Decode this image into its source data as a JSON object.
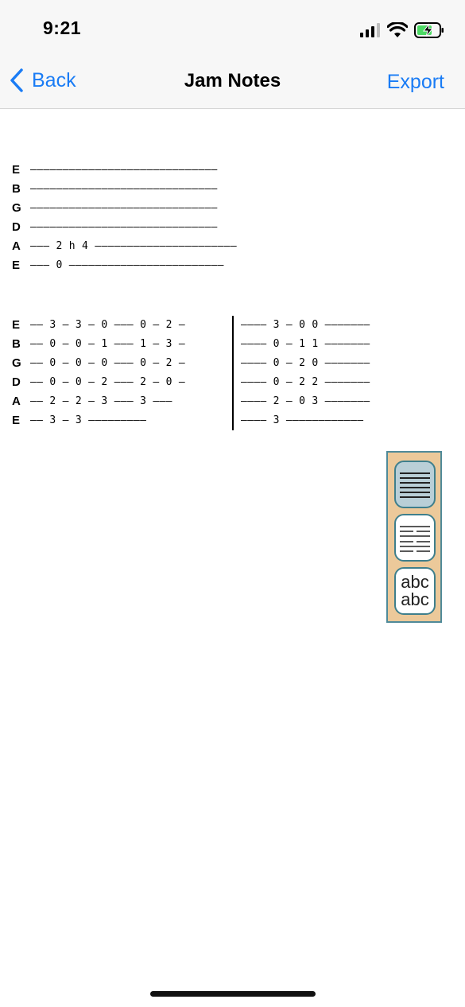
{
  "status": {
    "time": "9:21"
  },
  "nav": {
    "back_label": "Back",
    "title": "Jam Notes",
    "export_label": "Export"
  },
  "tab1": {
    "rows": [
      {
        "string": "E",
        "line": "—————————————————————————————"
      },
      {
        "string": "B",
        "line": "—————————————————————————————"
      },
      {
        "string": "G",
        "line": "—————————————————————————————"
      },
      {
        "string": "D",
        "line": "—————————————————————————————"
      },
      {
        "string": "A",
        "line": "——— 2 h 4 ——————————————————————"
      },
      {
        "string": "E",
        "line": "——— 0 ————————————————————————"
      }
    ]
  },
  "tab2": {
    "rows": [
      {
        "string": "E",
        "m1": "—— 3 — 3 — 0 ——— 0 — 2 —",
        "m2": "———— 3 — 0 0 ———————"
      },
      {
        "string": "B",
        "m1": "—— 0 — 0 — 1 ——— 1 — 3 —",
        "m2": "———— 0 — 1 1 ———————"
      },
      {
        "string": "G",
        "m1": "—— 0 — 0 — 0 ——— 0 — 2 —",
        "m2": "———— 0 — 2 0 ———————"
      },
      {
        "string": "D",
        "m1": "—— 0 — 0 — 2 ——— 2 — 0 —",
        "m2": "———— 0 — 2 2 ———————"
      },
      {
        "string": "A",
        "m1": "—— 2 — 2 — 3 ——— 3 ———",
        "m2": "———— 2 — 0 3 ———————"
      },
      {
        "string": "E",
        "m1": "—— 3 — 3 —————————",
        "m2": "———— 3 ————————————"
      }
    ]
  },
  "toolbox": {
    "items": [
      {
        "icon": "staff-lines-icon",
        "active": true
      },
      {
        "icon": "tab-lines-icon",
        "active": false
      },
      {
        "icon": "text-icon",
        "label_top": "abc",
        "label_bottom": "abc",
        "active": false
      }
    ]
  },
  "colors": {
    "accent": "#1a7cf5",
    "toolbox_bg": "#ecc99a",
    "toolbox_border": "#4f8a99",
    "active_tool": "#b9cfd7"
  }
}
